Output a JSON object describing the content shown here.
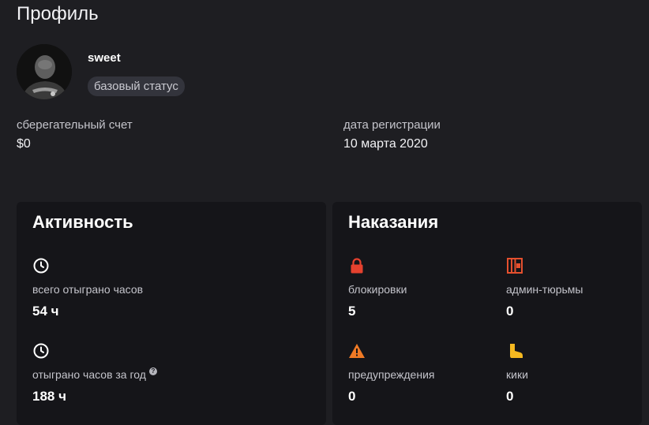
{
  "page": {
    "title": "Профиль"
  },
  "profile": {
    "username": "sweet",
    "status": "базовый статус",
    "savings_label": "сберегательный счет",
    "savings_value": "$0",
    "registration_label": "дата регистрации",
    "registration_value": "10 марта 2020"
  },
  "activity": {
    "title": "Активность",
    "items": [
      {
        "icon": "clock-icon",
        "label": "всего отыграно часов",
        "value": "54 ч"
      },
      {
        "icon": "clock-icon",
        "label": "отыграно часов за год",
        "value": "188 ч",
        "help": "?"
      }
    ]
  },
  "punishments": {
    "title": "Наказания",
    "items": [
      {
        "icon": "lock-icon",
        "color": "#e5412e",
        "label": "блокировки",
        "value": "5"
      },
      {
        "icon": "jail-icon",
        "color": "#e5502e",
        "label": "админ-тюрьмы",
        "value": "0"
      },
      {
        "icon": "warning-icon",
        "color": "#f07a25",
        "label": "предупреждения",
        "value": "0"
      },
      {
        "icon": "boot-icon",
        "color": "#f5b820",
        "label": "кики",
        "value": "0"
      }
    ]
  }
}
